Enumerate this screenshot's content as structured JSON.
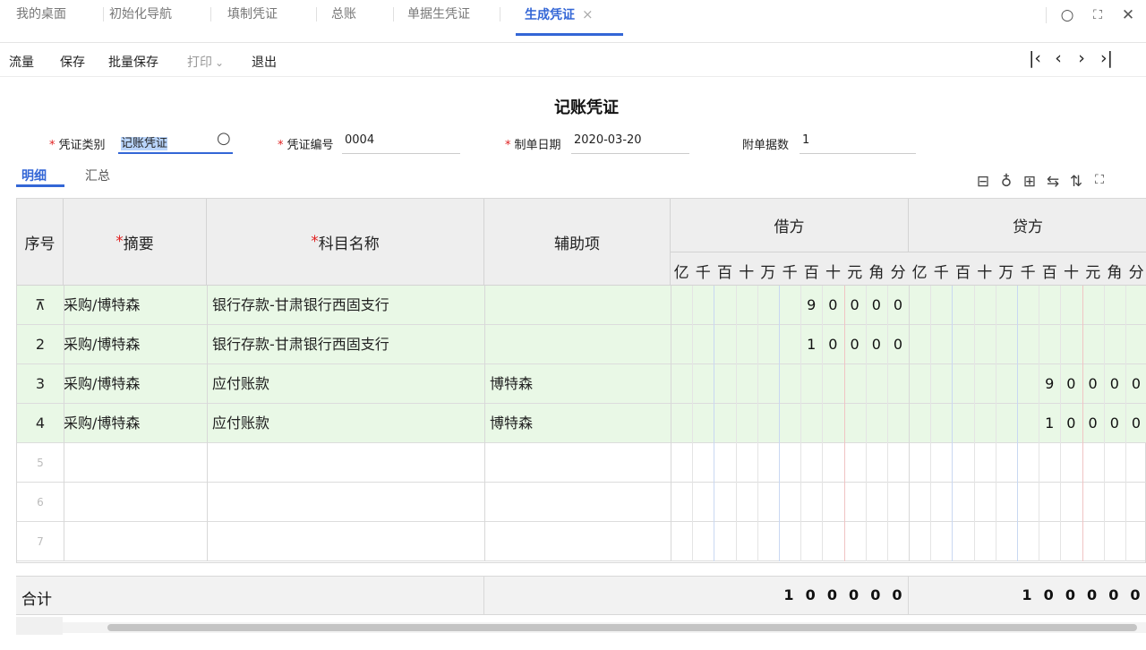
{
  "tabs": [
    {
      "label": "我的桌面"
    },
    {
      "label": "初始化导航"
    },
    {
      "label": "填制凭证"
    },
    {
      "label": "总账"
    },
    {
      "label": "单据生凭证"
    },
    {
      "label": "生成凭证",
      "close": "×"
    }
  ],
  "window_buttons": {
    "search": "○",
    "fullscreen": "⛶",
    "close": "✕"
  },
  "toolbar": {
    "flow": "流量",
    "save": "保存",
    "batch_save": "批量保存",
    "print": "打印",
    "print_caret": "⌄",
    "exit": "退出"
  },
  "nav": {
    "first": "|‹",
    "prev": "‹",
    "next": "›",
    "last": "›|"
  },
  "voucher": {
    "title": "记账凭证",
    "type_label": "凭证类别",
    "type_value": "记账凭证",
    "number_label": "凭证编号",
    "number_value": "0004",
    "date_label": "制单日期",
    "date_value": "2020-03-20",
    "attach_label": "附单据数",
    "attach_value": "1"
  },
  "subtabs": {
    "detail": "明细",
    "summary": "汇总"
  },
  "columns": {
    "seq": "序号",
    "summary": "摘要",
    "account": "科目名称",
    "aux": "辅助项",
    "debit": "借方",
    "credit": "贷方",
    "digit_units": [
      "亿",
      "千",
      "百",
      "十",
      "万",
      "千",
      "百",
      "十",
      "元",
      "角",
      "分"
    ]
  },
  "rows": [
    {
      "seq": "⊼",
      "summary": "采购/博特森",
      "account": "银行存款-甘肃银行西固支行",
      "aux": "",
      "debit": "90000",
      "credit": ""
    },
    {
      "seq": "2",
      "summary": "采购/博特森",
      "account": "银行存款-甘肃银行西固支行",
      "aux": "",
      "debit": "10000",
      "credit": ""
    },
    {
      "seq": "3",
      "summary": "采购/博特森",
      "account": "应付账款",
      "aux": "博特森",
      "debit": "",
      "credit": "90000"
    },
    {
      "seq": "4",
      "summary": "采购/博特森",
      "account": "应付账款",
      "aux": "博特森",
      "debit": "",
      "credit": "10000"
    },
    {
      "seq": "5",
      "summary": "",
      "account": "",
      "aux": "",
      "debit": "",
      "credit": ""
    },
    {
      "seq": "6",
      "summary": "",
      "account": "",
      "aux": "",
      "debit": "",
      "credit": ""
    },
    {
      "seq": "7",
      "summary": "",
      "account": "",
      "aux": "",
      "debit": "",
      "credit": ""
    }
  ],
  "total": {
    "label": "合计",
    "debit": "100000",
    "credit": "100000"
  },
  "colors": {
    "accent": "#3366d6",
    "row_fill": "#e9f8e6",
    "required": "#e02020"
  }
}
